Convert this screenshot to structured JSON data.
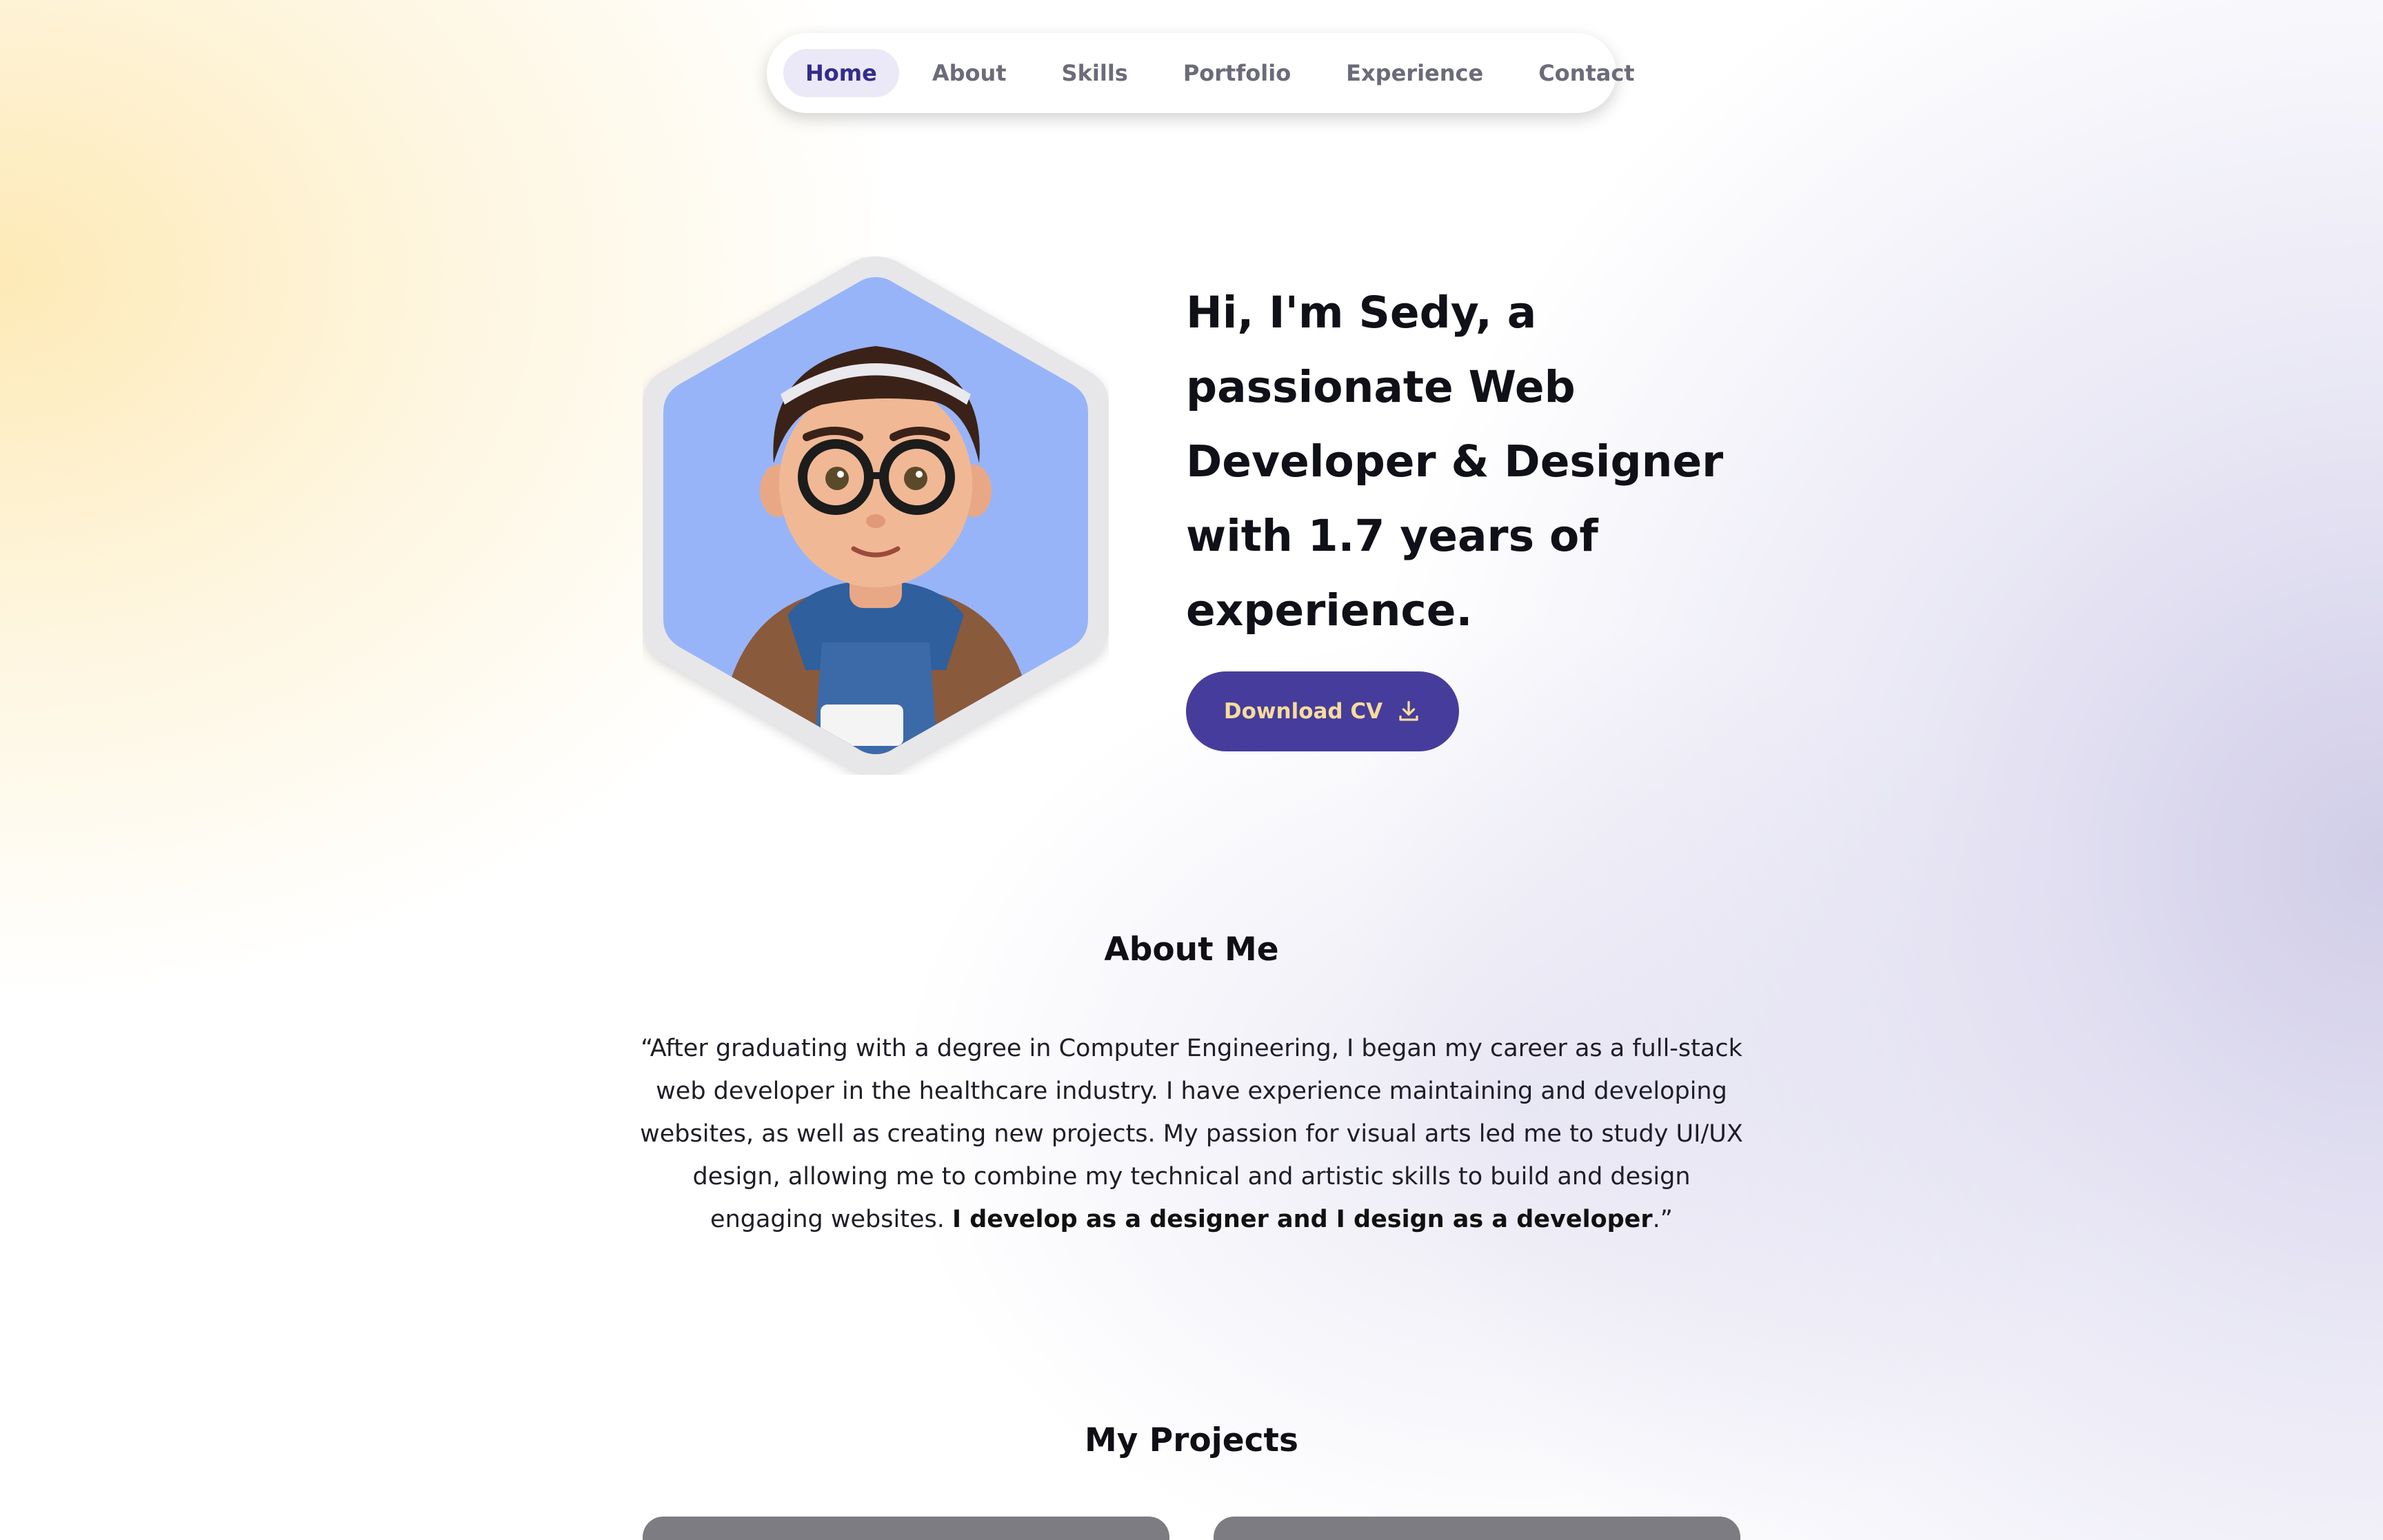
{
  "nav": {
    "items": [
      {
        "label": "Home",
        "active": true
      },
      {
        "label": "About",
        "active": false
      },
      {
        "label": "Skills",
        "active": false
      },
      {
        "label": "Portfolio",
        "active": false
      },
      {
        "label": "Experience",
        "active": false
      },
      {
        "label": "Contact",
        "active": false
      }
    ]
  },
  "hero": {
    "title": "Hi, I'm Sedy, a passionate Web Developer & Designer with 1.7 years of experience.",
    "cv_button_label": "Download CV",
    "cv_icon": "download-icon"
  },
  "about": {
    "title": "About Me",
    "text_start": "“After graduating with a degree in Computer Engineering, I began my career as a full-stack web developer in the healthcare industry. I have experience maintaining and developing websites, as well as creating new projects. My passion for visual arts led me to study UI/UX design, allowing me to combine my technical and artistic skills to build and design engaging websites. ",
    "text_bold": "I develop as a designer and I design as a developer",
    "text_end": ".”"
  },
  "projects": {
    "title": "My Projects"
  },
  "colors": {
    "accent": "#463c9c",
    "button_text": "#f6dc9c",
    "nav_active_bg": "#ebe9f8",
    "avatar_bg": "#98b4f8"
  }
}
